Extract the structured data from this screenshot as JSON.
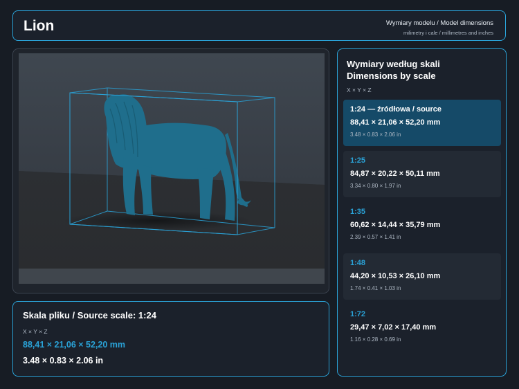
{
  "header": {
    "title": "Lion",
    "subtitle": "Wymiary modelu / Model dimensions",
    "units_note": "milimetry i cale / millimetres and inches"
  },
  "colors": {
    "accent": "#2aa3d8",
    "active_bg": "#154a68",
    "panel_bg": "#1b212b",
    "page_bg": "#171c24",
    "model": "#1f6e8c"
  },
  "viewport": {
    "model_icon": "lion-model",
    "bounding_box_icon": "bounding-box-wireframe"
  },
  "source": {
    "title": "Skala pliku / Source scale: 1:24",
    "axes": "X × Y × Z",
    "mm": "88,41 × 21,06 × 52,20 mm",
    "inches": "3.48 × 0.83 × 2.06 in"
  },
  "scales_panel": {
    "title_pl": "Wymiary według skali",
    "title_en": "Dimensions by scale",
    "axes": "X × Y × Z",
    "items": [
      {
        "label": "1:24  —  źródłowa / source",
        "mm": "88,41 × 21,06 × 52,20 mm",
        "inches": "3.48 × 0.83 × 2.06 in"
      },
      {
        "label": "1:25",
        "mm": "84,87 × 20,22 × 50,11 mm",
        "inches": "3.34 × 0.80 × 1.97 in"
      },
      {
        "label": "1:35",
        "mm": "60,62 × 14,44 × 35,79 mm",
        "inches": "2.39 × 0.57 × 1.41 in"
      },
      {
        "label": "1:48",
        "mm": "44,20 × 10,53 × 26,10 mm",
        "inches": "1.74 × 0.41 × 1.03 in"
      },
      {
        "label": "1:72",
        "mm": "29,47 × 7,02 × 17,40 mm",
        "inches": "1.16 × 0.28 × 0.69 in"
      }
    ]
  }
}
